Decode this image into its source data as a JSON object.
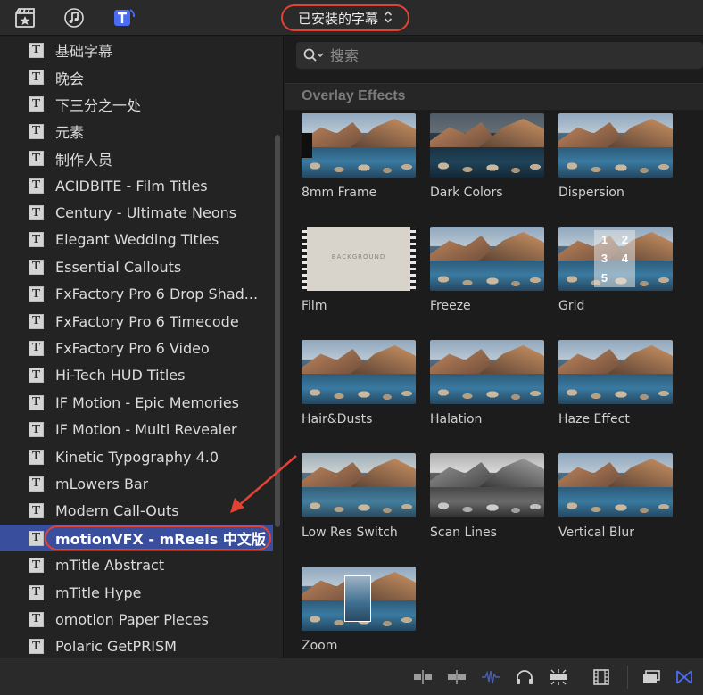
{
  "topbar": {
    "icons": [
      "clapper-star-icon",
      "music-note-icon",
      "titles-icon"
    ],
    "library_selector": "已安装的字幕",
    "selector_chevron": "⌃⌄"
  },
  "sidebar": {
    "items": [
      {
        "label": "基础字幕"
      },
      {
        "label": "晚会"
      },
      {
        "label": "下三分之一处"
      },
      {
        "label": "元素"
      },
      {
        "label": "制作人员"
      },
      {
        "label": "ACIDBITE - Film Titles"
      },
      {
        "label": "Century - Ultimate Neons"
      },
      {
        "label": "Elegant Wedding Titles"
      },
      {
        "label": "Essential Callouts"
      },
      {
        "label": "FxFactory Pro 6 Drop Shad..."
      },
      {
        "label": "FxFactory Pro 6 Timecode"
      },
      {
        "label": "FxFactory Pro 6 Video"
      },
      {
        "label": "Hi-Tech HUD Titles"
      },
      {
        "label": "IF Motion - Epic Memories"
      },
      {
        "label": "IF Motion - Multi Revealer"
      },
      {
        "label": "Kinetic Typography 4.0"
      },
      {
        "label": "mLowers Bar"
      },
      {
        "label": "Modern Call-Outs"
      },
      {
        "label": "motionVFX - mReels 中文版",
        "selected": true
      },
      {
        "label": "mTitle Abstract"
      },
      {
        "label": "mTitle Hype"
      },
      {
        "label": "omotion Paper Pieces"
      },
      {
        "label": "Polaric GetPRISM"
      }
    ]
  },
  "search": {
    "placeholder": "搜索"
  },
  "section": {
    "title": "Overlay Effects"
  },
  "tiles": [
    {
      "label": "8mm Frame"
    },
    {
      "label": "Dark Colors"
    },
    {
      "label": "Dispersion"
    },
    {
      "label": "Film"
    },
    {
      "label": "Freeze"
    },
    {
      "label": "Grid"
    },
    {
      "label": "Hair&Dusts"
    },
    {
      "label": "Halation"
    },
    {
      "label": "Haze Effect"
    },
    {
      "label": "Low Res Switch"
    },
    {
      "label": "Scan Lines"
    },
    {
      "label": "Vertical Blur"
    },
    {
      "label": "Zoom"
    }
  ],
  "film_thumb_text": "BACKGROUND",
  "grid_thumb_numbers": [
    "1",
    "2",
    "3",
    "4",
    "5"
  ],
  "colors": {
    "accent": "#e04334",
    "selection": "#3a4e9e",
    "brand_blue": "#4a6cf2"
  }
}
